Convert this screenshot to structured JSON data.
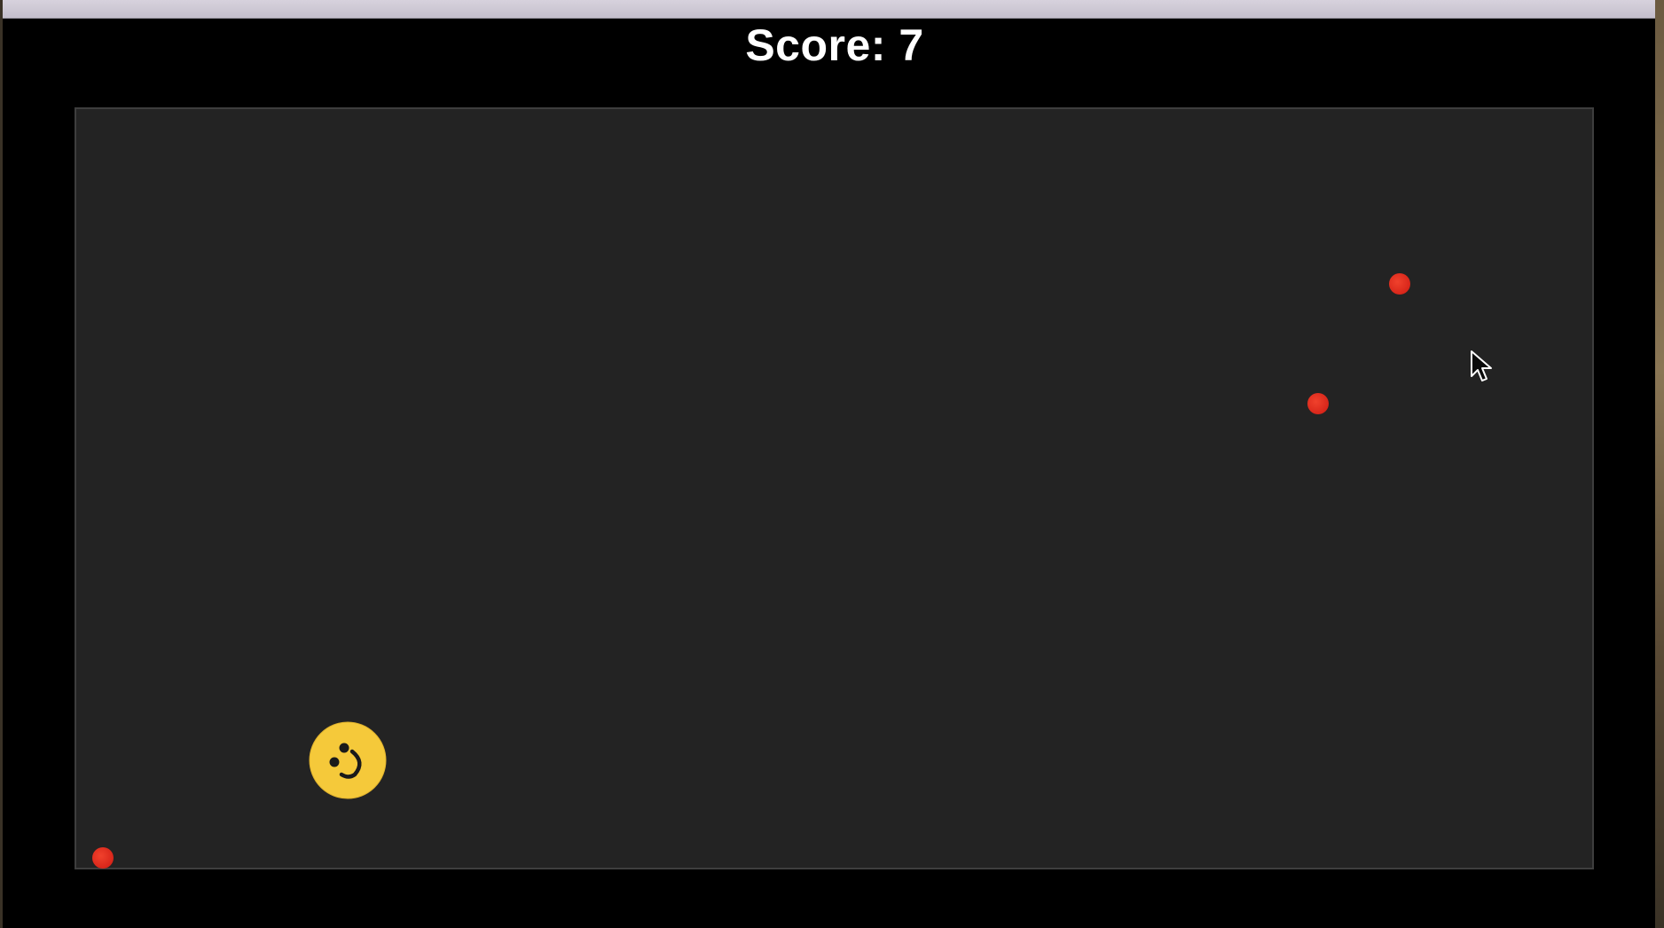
{
  "game": {
    "score_label": "Score: 7",
    "score": 7
  },
  "colors": {
    "background": "#000000",
    "arena": "#232323",
    "enemy": "#e0291c",
    "player": "#f5c93a"
  },
  "player": {
    "icon": "smiley-face-icon"
  },
  "enemies": [
    {
      "icon": "red-dot"
    },
    {
      "icon": "red-dot"
    },
    {
      "icon": "red-dot"
    }
  ]
}
